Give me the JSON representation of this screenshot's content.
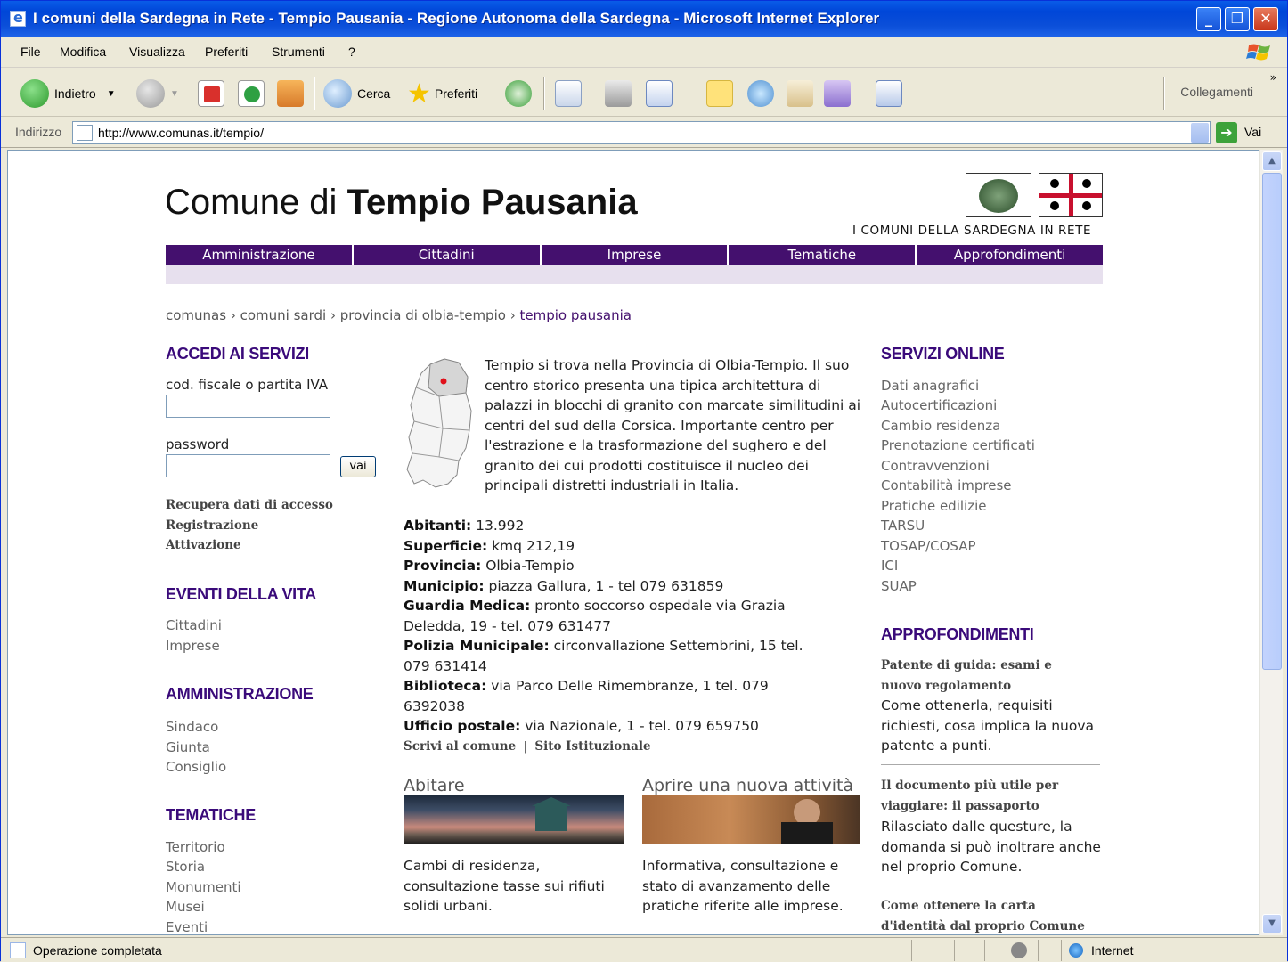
{
  "window": {
    "title": "I comuni della Sardegna in Rete - Tempio Pausania - Regione Autonoma della Sardegna - Microsoft Internet Explorer"
  },
  "menu": [
    "File",
    "Modifica",
    "Visualizza",
    "Preferiti",
    "Strumenti",
    "?"
  ],
  "toolbar": {
    "back_label": "Indietro",
    "search_label": "Cerca",
    "favorites_label": "Preferiti",
    "links_label": "Collegamenti"
  },
  "address": {
    "label": "Indirizzo",
    "url": "http://www.comunas.it/tempio/",
    "go_label": "Vai"
  },
  "status": {
    "text": "Operazione completata",
    "zone": "Internet"
  },
  "page": {
    "title_prefix": "Comune di ",
    "title_name": "Tempio Pausania",
    "network_label": "I COMUNI DELLA SARDEGNA IN RETE",
    "nav": [
      "Amministrazione",
      "Cittadini",
      "Imprese",
      "Tematiche",
      "Approfondimenti"
    ],
    "breadcrumb": {
      "items": [
        "comunas",
        "comuni sardi",
        "provincia di olbia-tempio"
      ],
      "current": "tempio pausania",
      "sep": "›"
    },
    "login": {
      "heading": "ACCEDI AI SERVIZI",
      "user_label": "cod. fiscale o partita IVA",
      "user_value": "",
      "pass_label": "password",
      "pass_value": "",
      "submit_label": "vai",
      "links": [
        "Recupera dati di accesso",
        "Registrazione",
        "Attivazione"
      ]
    },
    "eventi": {
      "heading": "EVENTI DELLA VITA",
      "links": [
        "Cittadini",
        "Imprese"
      ]
    },
    "amministrazione": {
      "heading": "AMMINISTRAZIONE",
      "links": [
        "Sindaco",
        "Giunta",
        "Consiglio"
      ]
    },
    "tematiche": {
      "heading": "TEMATICHE",
      "links": [
        "Territorio",
        "Storia",
        "Monumenti",
        "Musei",
        "Eventi"
      ]
    },
    "intro": "Tempio si trova nella Provincia di Olbia-Tempio. Il suo centro storico presenta una tipica architettura di palazzi in blocchi di granito con marcate similitudini ai centri del sud della Corsica. Importante centro per l'estrazione e la trasformazione del sughero e del granito dei cui prodotti costituisce il nucleo dei principali distretti industriali in Italia.",
    "info": [
      {
        "k": "Abitanti:",
        "v": " 13.992"
      },
      {
        "k": "Superficie:",
        "v": " kmq 212,19"
      },
      {
        "k": "Provincia:",
        "v": " Olbia-Tempio"
      },
      {
        "k": "Municipio:",
        "v": " piazza Gallura, 1 - tel  079 631859"
      },
      {
        "k": "Guardia Medica:",
        "v": " pronto soccorso ospedale via Grazia Deledda, 19 - tel. 079 631477"
      },
      {
        "k": "Polizia Municipale:",
        "v": " circonvallazione Settembrini, 15 tel. 079 631414"
      },
      {
        "k": "Biblioteca:",
        "v": " via Parco Delle Rimembranze, 1 tel. 079 6392038"
      },
      {
        "k": "Ufficio postale:",
        "v": " via Nazionale, 1 - tel. 079 659750"
      }
    ],
    "bottom_links": [
      "Scrivi al comune",
      "Sito Istituzionale"
    ],
    "bottom_sep": "|",
    "features": [
      {
        "title": "Abitare",
        "text": "Cambi di residenza, consultazione tasse sui rifiuti solidi urbani."
      },
      {
        "title": "Aprire una nuova attività",
        "text": "Informativa, consultazione e stato di avanzamento delle pratiche riferite alle imprese."
      }
    ],
    "servizi": {
      "heading": "SERVIZI ONLINE",
      "links": [
        "Dati anagrafici",
        "Autocertificazioni",
        "Cambio residenza",
        "Prenotazione certificati",
        "Contravvenzioni",
        "Contabilità imprese",
        "Pratiche edilizie",
        "TARSU",
        "TOSAP/COSAP",
        "ICI",
        "SUAP"
      ]
    },
    "approfondimenti": {
      "heading": "APPROFONDIMENTI",
      "items": [
        {
          "title": "Patente di guida: esami e nuovo regolamento",
          "text": "Come ottenerla, requisiti richiesti, cosa implica la nuova patente a punti."
        },
        {
          "title": "Il documento più utile per viaggiare: il passaporto",
          "text": "Rilasciato dalle questure, la domanda si può inoltrare anche nel proprio Comune."
        },
        {
          "title": "Come ottenere la carta d'identità dal proprio Comune",
          "text": ""
        }
      ]
    }
  },
  "colors": {
    "brand": "#44106e",
    "heading": "#3a0a7a",
    "ie_blue": "#0b4fd9"
  }
}
